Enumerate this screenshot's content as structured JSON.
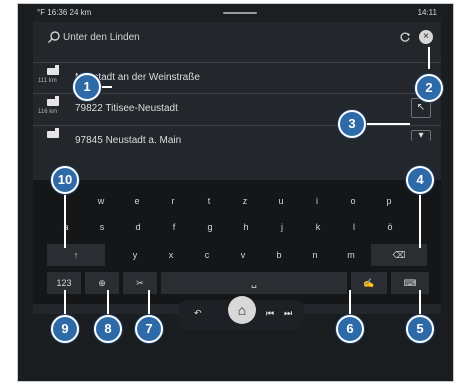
{
  "status_bar": {
    "left": "°F 16:36   24 km",
    "right": "14:11"
  },
  "search": {
    "text": "Unter den Linden",
    "clear_icon": "close-icon",
    "refresh_icon": "refresh-icon",
    "search_icon": "search-icon"
  },
  "results": [
    {
      "distance": "111 km",
      "address": "Neustadt an der Weinstraße"
    },
    {
      "distance": "116 km",
      "address": "79822 Titisee-Neustadt"
    },
    {
      "distance": "",
      "address": "97845 Neustadt a. Main"
    }
  ],
  "keyboard": {
    "row1": [
      "w",
      "e",
      "r",
      "t",
      "z",
      "u",
      "i",
      "o",
      "p"
    ],
    "row2": [
      "a",
      "s",
      "d",
      "f",
      "g",
      "h",
      "j",
      "k",
      "l",
      "ö"
    ],
    "row3": [
      "y",
      "x",
      "c",
      "v",
      "b",
      "n",
      "m"
    ],
    "shift_label": "↑",
    "backspace_label": "⌫",
    "numeric_label": "123",
    "globe_label": "⊕",
    "mic_label": "✂",
    "space_label": "␣",
    "handwriting_label": "✍",
    "hide_label": "⌨"
  },
  "dock": {
    "back": "↶",
    "home": "⌂",
    "prev": "⏮",
    "next": "⏭"
  },
  "callouts": [
    "1",
    "2",
    "3",
    "4",
    "5",
    "6",
    "7",
    "8",
    "9",
    "10"
  ],
  "colors": {
    "callout": "#2e6aa8",
    "screen": "#23272b",
    "keyboard": "#141618"
  }
}
